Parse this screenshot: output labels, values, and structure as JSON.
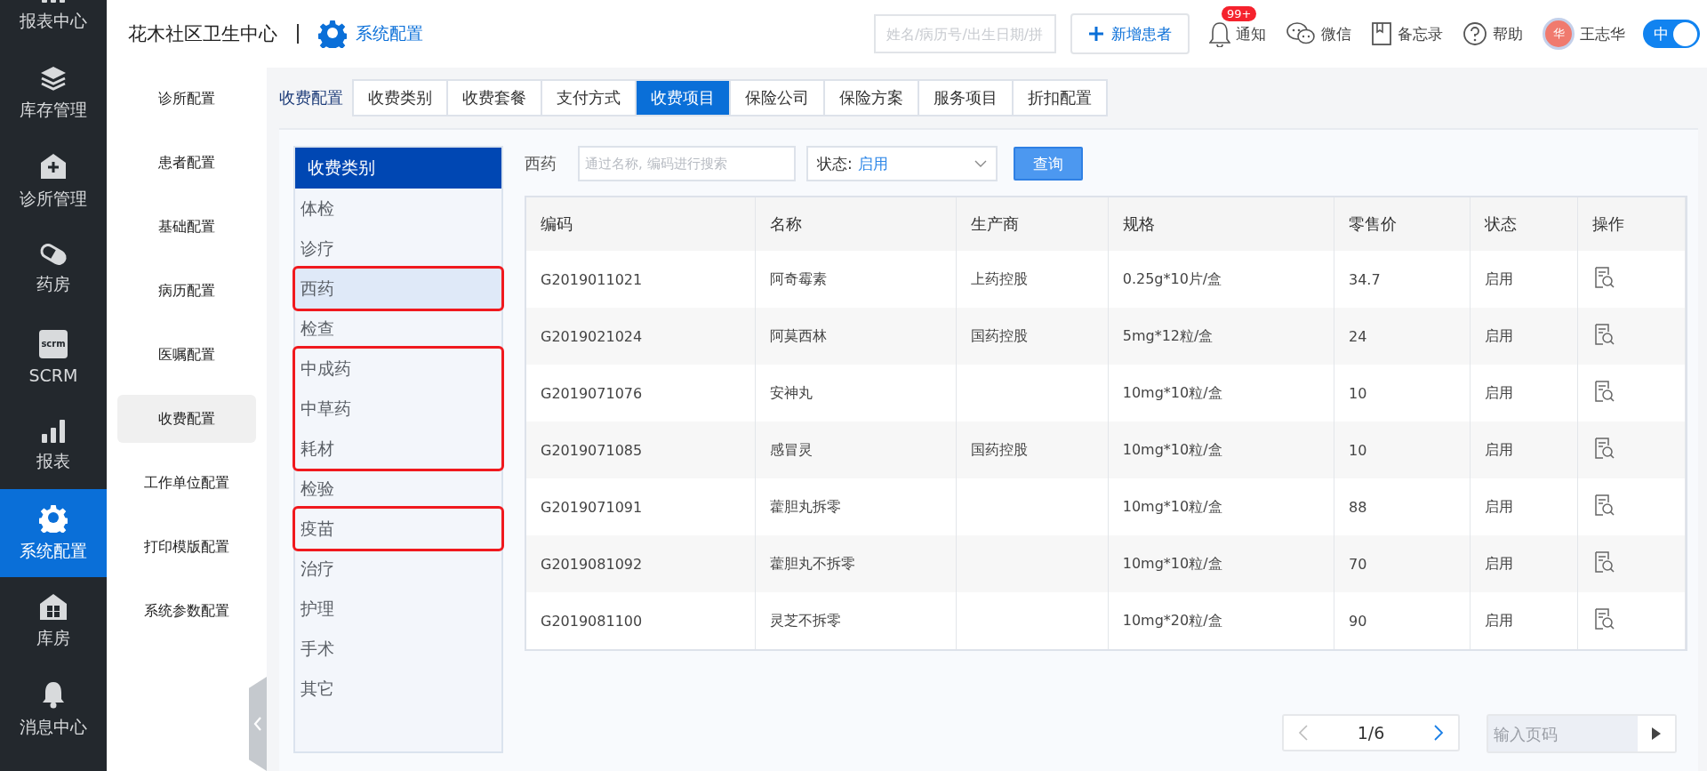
{
  "nav": [
    {
      "label": "报表中心",
      "kind": "chart",
      "selected": false
    },
    {
      "label": "库存管理",
      "kind": "layers",
      "selected": false
    },
    {
      "label": "诊所管理",
      "kind": "clinic",
      "selected": false
    },
    {
      "label": "药房",
      "kind": "pill",
      "selected": false
    },
    {
      "label": "SCRM",
      "kind": "scrm",
      "icon_text": "scrm",
      "selected": false
    },
    {
      "label": "报表",
      "kind": "chart",
      "selected": false
    },
    {
      "label": "系统配置",
      "kind": "gear",
      "selected": true
    },
    {
      "label": "库房",
      "kind": "warehouse",
      "selected": false
    },
    {
      "label": "消息中心",
      "kind": "bell",
      "selected": false
    }
  ],
  "header": {
    "org": "花木社区卫生中心",
    "section": "系统配置",
    "search_placeholder": "姓名/病历号/出生日期/拼",
    "add_button": "新增患者",
    "tools": [
      {
        "label": "通知",
        "kind": "bell",
        "badge": "99+"
      },
      {
        "label": "微信",
        "kind": "chat"
      },
      {
        "label": "备忘录",
        "kind": "book"
      },
      {
        "label": "帮助",
        "kind": "help"
      }
    ],
    "user": {
      "avatar_text": "华",
      "name": "王志华"
    },
    "lang_toggle": {
      "label": "中",
      "on": true
    }
  },
  "sub_nav": [
    {
      "label": "诊所配置",
      "selected": false
    },
    {
      "label": "患者配置",
      "selected": false
    },
    {
      "label": "基础配置",
      "selected": false
    },
    {
      "label": "病历配置",
      "selected": false
    },
    {
      "label": "医嘱配置",
      "selected": false
    },
    {
      "label": "收费配置",
      "selected": true
    },
    {
      "label": "工作单位配置",
      "selected": false
    },
    {
      "label": "打印模版配置",
      "selected": false
    },
    {
      "label": "系统参数配置",
      "selected": false
    }
  ],
  "tabs_title": "收费配置",
  "tabs": [
    {
      "label": "收费类别",
      "selected": false
    },
    {
      "label": "收费套餐",
      "selected": false
    },
    {
      "label": "支付方式",
      "selected": false
    },
    {
      "label": "收费项目",
      "selected": true
    },
    {
      "label": "保险公司",
      "selected": false
    },
    {
      "label": "保险方案",
      "selected": false
    },
    {
      "label": "服务项目",
      "selected": false
    },
    {
      "label": "折扣配置",
      "selected": false
    }
  ],
  "category_title": "收费类别",
  "categories": [
    {
      "label": "体检",
      "selected": false,
      "circled": false
    },
    {
      "label": "诊疗",
      "selected": false,
      "circled": false
    },
    {
      "label": "西药",
      "selected": true,
      "circled": true
    },
    {
      "label": "检查",
      "selected": false,
      "circled": false
    },
    {
      "label": "中成药",
      "selected": false,
      "circled": true
    },
    {
      "label": "中草药",
      "selected": false,
      "circled": true
    },
    {
      "label": "耗材",
      "selected": false,
      "circled": true
    },
    {
      "label": "检验",
      "selected": false,
      "circled": false
    },
    {
      "label": "疫苗",
      "selected": false,
      "circled": true
    },
    {
      "label": "治疗",
      "selected": false,
      "circled": false
    },
    {
      "label": "护理",
      "selected": false,
      "circled": false
    },
    {
      "label": "手术",
      "selected": false,
      "circled": false
    },
    {
      "label": "其它",
      "selected": false,
      "circled": false
    }
  ],
  "filter": {
    "title": "西药",
    "search_placeholder": "通过名称, 编码进行搜索",
    "status_label": "状态:",
    "status_value": "启用",
    "query_button": "查询"
  },
  "table": {
    "columns": [
      "编码",
      "名称",
      "生产商",
      "规格",
      "零售价",
      "状态",
      "操作"
    ],
    "rows": [
      [
        "G2019011021",
        "阿奇霉素",
        "上药控股",
        "0.25g*10片/盒",
        "34.7",
        "启用"
      ],
      [
        "G2019021024",
        "阿莫西林",
        "国药控股",
        "5mg*12粒/盒",
        "24",
        "启用"
      ],
      [
        "G2019071076",
        "安神丸",
        "",
        "10mg*10粒/盒",
        "10",
        "启用"
      ],
      [
        "G2019071085",
        "感冒灵",
        "国药控股",
        "10mg*10粒/盒",
        "10",
        "启用"
      ],
      [
        "G2019071091",
        "藿胆丸拆零",
        "",
        "10mg*10粒/盒",
        "88",
        "启用"
      ],
      [
        "G2019081092",
        "藿胆丸不拆零",
        "",
        "10mg*10粒/盒",
        "70",
        "启用"
      ],
      [
        "G2019081100",
        "灵芝不拆零",
        "",
        "10mg*20粒/盒",
        "90",
        "启用"
      ]
    ]
  },
  "pagination": {
    "page": "1/6",
    "jump_placeholder": "输入页码"
  }
}
